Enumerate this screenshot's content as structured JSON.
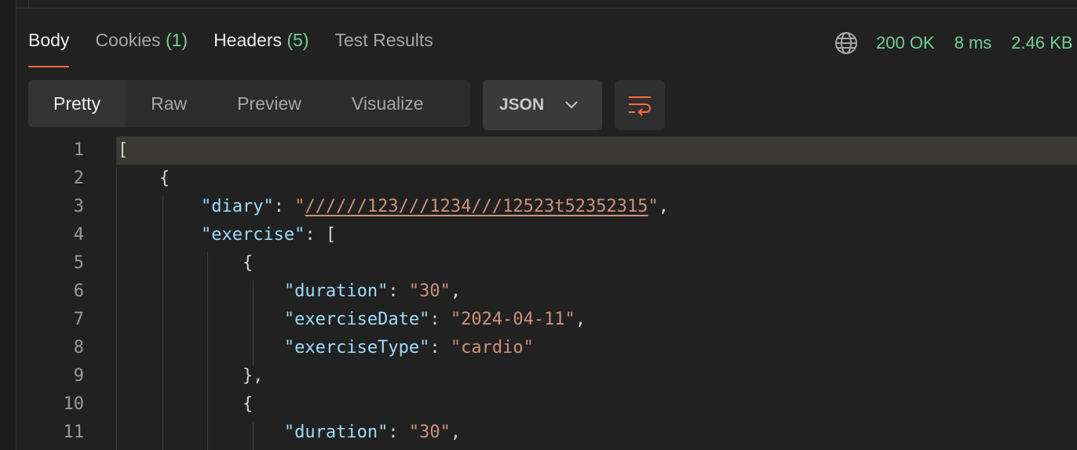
{
  "tabs": [
    {
      "label": "Body",
      "count": ""
    },
    {
      "label": "Cookies",
      "count": "(1)"
    },
    {
      "label": "Headers",
      "count": "(5)"
    },
    {
      "label": "Test Results",
      "count": ""
    }
  ],
  "status": {
    "code": "200 OK",
    "time": "8 ms",
    "size": "2.46 KB",
    "globe_icon": "globe-icon"
  },
  "view_modes": [
    "Pretty",
    "Raw",
    "Preview",
    "Visualize"
  ],
  "format": {
    "selected": "JSON"
  },
  "colors": {
    "accent": "#ff6c37",
    "status": "#6fcf97",
    "key": "#9cdcfe",
    "string": "#ce9178"
  },
  "code_lines": [
    {
      "n": "1",
      "parts": [
        {
          "t": "[",
          "c": "p"
        }
      ]
    },
    {
      "n": "2",
      "parts": [
        {
          "t": "    {",
          "c": "p"
        }
      ]
    },
    {
      "n": "3",
      "parts": [
        {
          "t": "        ",
          "c": "p"
        },
        {
          "t": "\"diary\"",
          "c": "k"
        },
        {
          "t": ": ",
          "c": "p"
        },
        {
          "t": "\"",
          "c": "s"
        },
        {
          "t": "//////123///1234///12523t52352315",
          "c": "s u"
        },
        {
          "t": "\"",
          "c": "s"
        },
        {
          "t": ",",
          "c": "p"
        }
      ]
    },
    {
      "n": "4",
      "parts": [
        {
          "t": "        ",
          "c": "p"
        },
        {
          "t": "\"exercise\"",
          "c": "k"
        },
        {
          "t": ": [",
          "c": "p"
        }
      ]
    },
    {
      "n": "5",
      "parts": [
        {
          "t": "            {",
          "c": "p"
        }
      ]
    },
    {
      "n": "6",
      "parts": [
        {
          "t": "                ",
          "c": "p"
        },
        {
          "t": "\"duration\"",
          "c": "k"
        },
        {
          "t": ": ",
          "c": "p"
        },
        {
          "t": "\"30\"",
          "c": "s"
        },
        {
          "t": ",",
          "c": "p"
        }
      ]
    },
    {
      "n": "7",
      "parts": [
        {
          "t": "                ",
          "c": "p"
        },
        {
          "t": "\"exerciseDate\"",
          "c": "k"
        },
        {
          "t": ": ",
          "c": "p"
        },
        {
          "t": "\"2024-04-11\"",
          "c": "s"
        },
        {
          "t": ",",
          "c": "p"
        }
      ]
    },
    {
      "n": "8",
      "parts": [
        {
          "t": "                ",
          "c": "p"
        },
        {
          "t": "\"exerciseType\"",
          "c": "k"
        },
        {
          "t": ": ",
          "c": "p"
        },
        {
          "t": "\"cardio\"",
          "c": "s"
        }
      ]
    },
    {
      "n": "9",
      "parts": [
        {
          "t": "            },",
          "c": "p"
        }
      ]
    },
    {
      "n": "10",
      "parts": [
        {
          "t": "            {",
          "c": "p"
        }
      ]
    },
    {
      "n": "11",
      "parts": [
        {
          "t": "                ",
          "c": "p"
        },
        {
          "t": "\"duration\"",
          "c": "k"
        },
        {
          "t": ": ",
          "c": "p"
        },
        {
          "t": "\"30\"",
          "c": "s"
        },
        {
          "t": ",",
          "c": "p"
        }
      ]
    }
  ]
}
